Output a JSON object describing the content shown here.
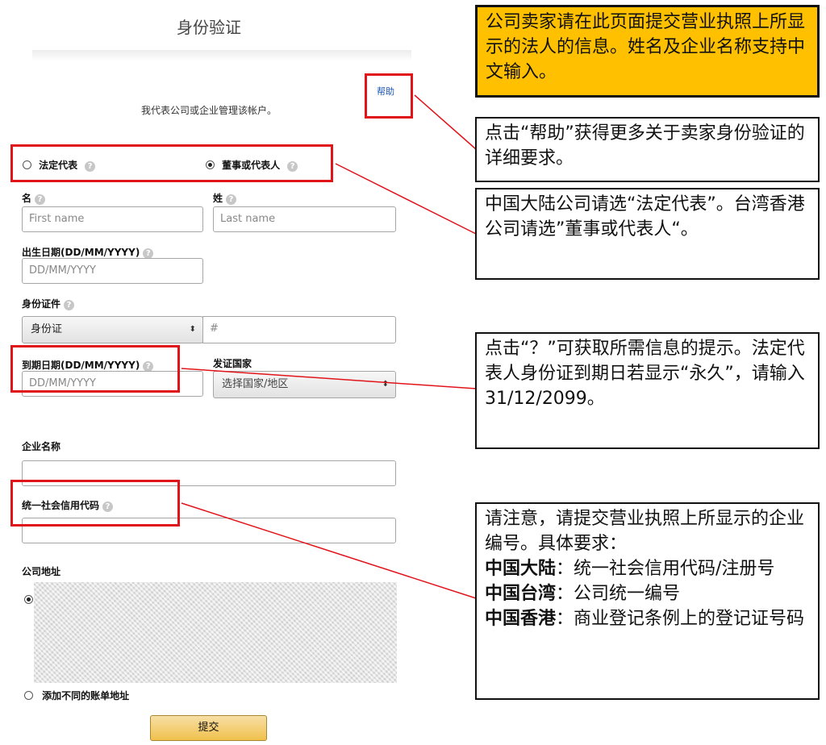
{
  "form": {
    "title": "身份验证",
    "subtitle": "我代表公司或企业管理该帐户。",
    "help_link": "帮助",
    "role_options": [
      "法定代表",
      "董事或代表人"
    ],
    "selected_role": "董事或代表人",
    "first_name_label": "名",
    "last_name_label": "姓",
    "first_name_placeholder": "First name",
    "last_name_placeholder": "Last name",
    "dob_label": "出生日期(DD/MM/YYYY)",
    "dob_placeholder": "DD/MM/YYYY",
    "id_doc_label": "身份证件",
    "id_doc_type": "身份证",
    "id_number_placeholder": "#",
    "expiry_label": "到期日期(DD/MM/YYYY)",
    "expiry_placeholder": "DD/MM/YYYY",
    "issuing_country_label": "发证国家",
    "issuing_country_value": "选择国家/地区",
    "company_name_label": "企业名称",
    "credit_code_label": "统一社会信用代码",
    "address_label": "公司地址",
    "add_billing_address": "添加不同的账单地址",
    "submit_label": "提交",
    "help_icon_glyph": "?"
  },
  "annotations": {
    "note_company": "公司卖家请在此页面提交营业执照上所显示的法人的信息。姓名及企业名称支持中文输入。",
    "note_help": "点击“帮助”获得更多关于卖家身份验证的详细要求。",
    "note_role": "中国大陆公司请选“法定代表”。台湾香港公司请选”董事或代表人“。",
    "note_tooltip": "点击“？”可获取所需信息的提示。法定代表人身份证到期日若显示“永久”，请输入31/12/2099。",
    "note_business_number_intro": "请注意，请提交营业执照上所显示的企业编号。具体要求：",
    "region_mainland": "中国大陆",
    "region_mainland_text": "：统一社会信用代码/注册号",
    "region_taiwan": "中国台湾",
    "region_taiwan_text": "：公司统一编号",
    "region_hongkong": "中国香港",
    "region_hongkong_text": "：商业登记条例上的登记证号码"
  },
  "colors": {
    "highlight_red": "#e1141a",
    "note_yellow": "#ffc000",
    "link_blue": "#1a57b5",
    "submit_gold": "#f0c14b"
  }
}
